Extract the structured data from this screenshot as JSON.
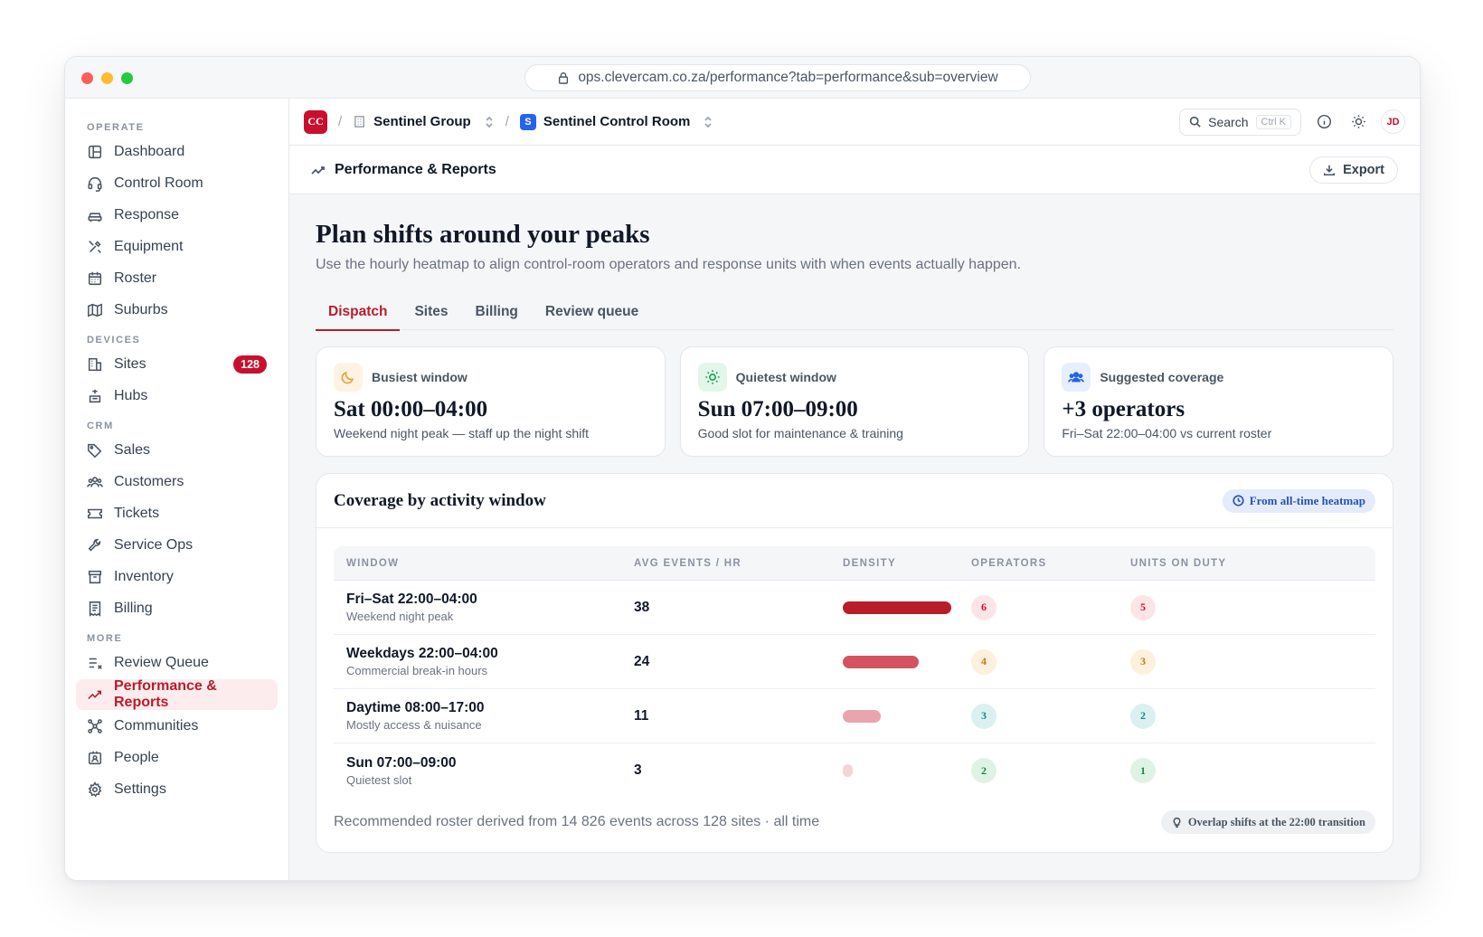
{
  "browser": {
    "url": "ops.clevercam.co.za/performance?tab=performance&sub=overview"
  },
  "sidebar": {
    "sections": [
      {
        "label": "OPERATE",
        "items": [
          {
            "label": "Dashboard",
            "icon": "layout-icon"
          },
          {
            "label": "Control Room",
            "icon": "headset-icon"
          },
          {
            "label": "Response",
            "icon": "car-icon"
          },
          {
            "label": "Equipment",
            "icon": "tools-icon"
          },
          {
            "label": "Roster",
            "icon": "calendar-icon"
          },
          {
            "label": "Suburbs",
            "icon": "map-icon"
          }
        ]
      },
      {
        "label": "DEVICES",
        "items": [
          {
            "label": "Sites",
            "icon": "building-icon",
            "badge": "128"
          },
          {
            "label": "Hubs",
            "icon": "hub-icon"
          }
        ]
      },
      {
        "label": "CRM",
        "items": [
          {
            "label": "Sales",
            "icon": "tag-icon"
          },
          {
            "label": "Customers",
            "icon": "users-icon"
          },
          {
            "label": "Tickets",
            "icon": "ticket-icon"
          },
          {
            "label": "Service Ops",
            "icon": "wrench-icon"
          },
          {
            "label": "Inventory",
            "icon": "archive-icon"
          },
          {
            "label": "Billing",
            "icon": "receipt-icon"
          }
        ]
      },
      {
        "label": "MORE",
        "items": [
          {
            "label": "Review Queue",
            "icon": "list-check-icon"
          },
          {
            "label": "Performance & Reports",
            "icon": "trend-icon",
            "active": true
          },
          {
            "label": "Communities",
            "icon": "network-icon"
          },
          {
            "label": "People",
            "icon": "id-card-icon"
          },
          {
            "label": "Settings",
            "icon": "gear-icon"
          }
        ]
      }
    ]
  },
  "topbar": {
    "logo": "CC",
    "org": "Sentinel Group",
    "room_badge": "S",
    "room": "Sentinel Control Room",
    "search_label": "Search",
    "search_shortcut": "Ctrl K",
    "avatar": "JD"
  },
  "pagebar": {
    "title": "Performance & Reports",
    "export_label": "Export"
  },
  "hero": {
    "title": "Plan shifts around your peaks",
    "subtitle": "Use the hourly heatmap to align control-room operators and response units with when events actually happen."
  },
  "tabs": [
    {
      "label": "Dispatch",
      "active": true
    },
    {
      "label": "Sites"
    },
    {
      "label": "Billing"
    },
    {
      "label": "Review queue"
    }
  ],
  "cards": [
    {
      "label": "Busiest window",
      "value": "Sat 00:00–04:00",
      "desc": "Weekend night peak — staff up the night shift",
      "icon": "moon-icon",
      "accent": "#e8a13a"
    },
    {
      "label": "Quietest window",
      "value": "Sun 07:00–09:00",
      "desc": "Good slot for maintenance & training",
      "icon": "sun-icon",
      "accent": "#16a34a"
    },
    {
      "label": "Suggested coverage",
      "value": "+3 operators",
      "desc": "Fri–Sat 22:00–04:00 vs current roster",
      "icon": "users-icon",
      "accent": "#2563eb"
    }
  ],
  "coverage": {
    "title": "Coverage by activity window",
    "source_pill": "From all-time heatmap",
    "columns": [
      "WINDOW",
      "AVG EVENTS / HR",
      "DENSITY",
      "OPERATORS",
      "UNITS ON DUTY"
    ],
    "rows": [
      {
        "window": "Fri–Sat 22:00–04:00",
        "note": "Weekend night peak",
        "avg": "38",
        "density": 1.0,
        "density_color": "#b91c2b",
        "operators": "6",
        "units": "5",
        "tone": "red"
      },
      {
        "window": "Weekdays 22:00–04:00",
        "note": "Commercial break-in hours",
        "avg": "24",
        "density": 0.7,
        "density_color": "#d3545f",
        "operators": "4",
        "units": "3",
        "tone": "amber"
      },
      {
        "window": "Daytime 08:00–17:00",
        "note": "Mostly access & nuisance",
        "avg": "11",
        "density": 0.35,
        "density_color": "#e8a5ad",
        "operators": "3",
        "units": "2",
        "tone": "teal"
      },
      {
        "window": "Sun 07:00–09:00",
        "note": "Quietest slot",
        "avg": "3",
        "density": 0.09,
        "density_color": "#f6d3d8",
        "operators": "2",
        "units": "1",
        "tone": "green"
      }
    ],
    "footer": "Recommended roster derived from 14 826 events across 128 sites · all time",
    "tip_pill": "Overlap shifts at the 22:00 transition"
  }
}
